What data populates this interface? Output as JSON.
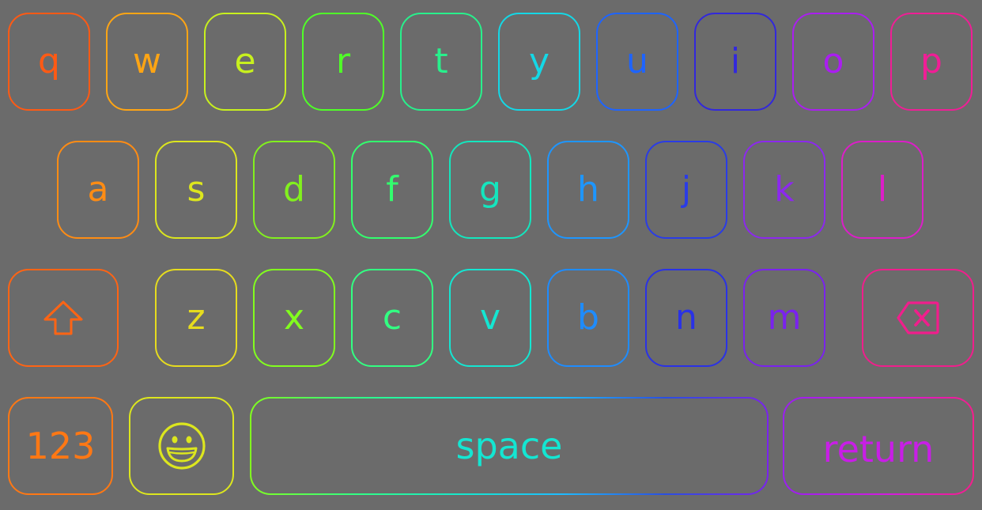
{
  "keyboard": {
    "rows": [
      [
        {
          "label": "q",
          "color": "#ff5a14"
        },
        {
          "label": "w",
          "color": "#ffa514"
        },
        {
          "label": "e",
          "color": "#c8f01e"
        },
        {
          "label": "r",
          "color": "#50ff28"
        },
        {
          "label": "t",
          "color": "#28f08c"
        },
        {
          "label": "y",
          "color": "#14d8e6"
        },
        {
          "label": "u",
          "color": "#1e64ff"
        },
        {
          "label": "i",
          "color": "#3228dc"
        },
        {
          "label": "o",
          "color": "#aa1ef0"
        },
        {
          "label": "p",
          "color": "#f01e96"
        }
      ],
      [
        {
          "label": "a",
          "color": "#ff8c14"
        },
        {
          "label": "s",
          "color": "#dce61e"
        },
        {
          "label": "d",
          "color": "#82f01e"
        },
        {
          "label": "f",
          "color": "#32ff6e"
        },
        {
          "label": "g",
          "color": "#14e6be"
        },
        {
          "label": "h",
          "color": "#1e96ff"
        },
        {
          "label": "j",
          "color": "#2a3ce6"
        },
        {
          "label": "k",
          "color": "#8c28ee"
        },
        {
          "label": "l",
          "color": "#dc1ec8"
        }
      ],
      [
        {
          "label": "z",
          "color": "#e6dc1e"
        },
        {
          "label": "x",
          "color": "#82ff1e"
        },
        {
          "label": "c",
          "color": "#32ff82"
        },
        {
          "label": "v",
          "color": "#14e6d2"
        },
        {
          "label": "b",
          "color": "#1e8cff"
        },
        {
          "label": "n",
          "color": "#2a32e6"
        },
        {
          "label": "m",
          "color": "#7a22ee"
        }
      ]
    ],
    "shift": {
      "icon": "shift-arrow-icon",
      "color": "#ff6414"
    },
    "backspace": {
      "icon": "backspace-icon",
      "color": "#f01e8c"
    },
    "numbers": {
      "label": "123",
      "color": "#ff7814"
    },
    "emoji": {
      "icon": "smiley-face-icon",
      "color": "#dce61e"
    },
    "space": {
      "label": "space",
      "color": "#14e6d2"
    },
    "return": {
      "label": "return",
      "color": "#c81ee6"
    }
  }
}
